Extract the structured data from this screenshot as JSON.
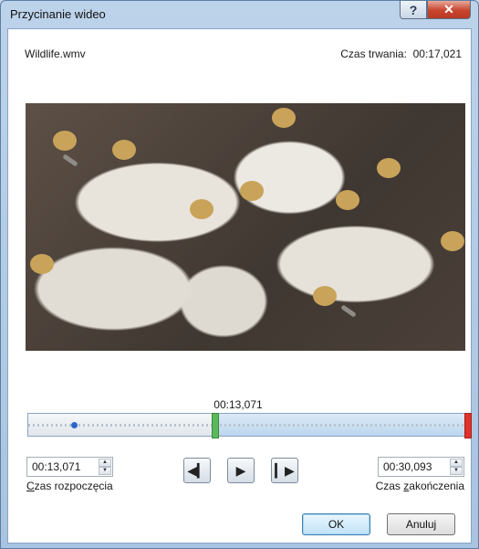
{
  "window": {
    "title": "Przycinanie wideo",
    "help_label": "?",
    "close_label": "✕"
  },
  "file": {
    "name": "Wildlife.wmv",
    "duration_label": "Czas trwania:",
    "duration_value": "00:17,021"
  },
  "timeline": {
    "current_time": "00:13,071",
    "playhead_position_fraction": 0.11,
    "start_fraction": 0.43,
    "end_fraction": 1.0
  },
  "start": {
    "value": "00:13,071",
    "label_prefix": "C",
    "label_rest": "zas rozpoczęcia"
  },
  "end": {
    "value": "00:30,093",
    "label_prefix": "Czas ",
    "label_accel": "z",
    "label_rest": "akończenia"
  },
  "controls": {
    "prev_icon": "previous-frame-icon",
    "play_icon": "play-icon",
    "next_icon": "next-frame-icon"
  },
  "buttons": {
    "ok": "OK",
    "cancel": "Anuluj"
  },
  "colors": {
    "start_marker": "#5cb85c",
    "end_marker": "#e0322a",
    "playhead": "#2a66c8"
  }
}
